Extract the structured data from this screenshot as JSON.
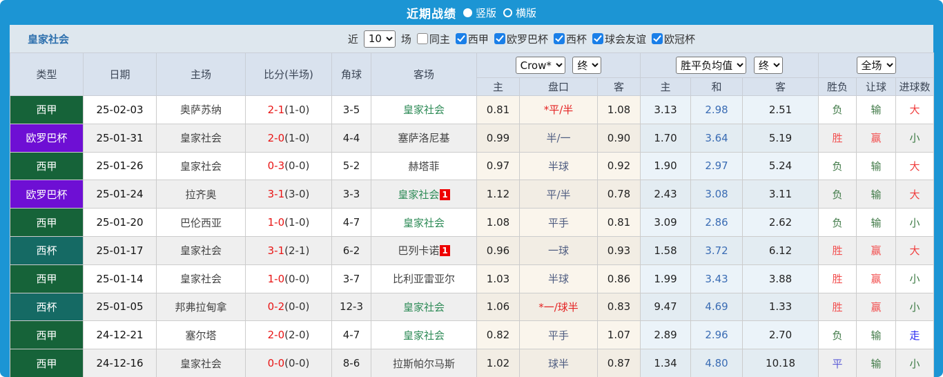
{
  "titlebar": {
    "title": "近期战绩",
    "options": [
      "竖版",
      "横版"
    ],
    "selected": "竖版"
  },
  "filterbar": {
    "team": "皇家社会",
    "near_label": "近",
    "count_value": "10",
    "games_label": "场",
    "checkboxes": [
      {
        "label": "同主",
        "checked": false
      },
      {
        "label": "西甲",
        "checked": true
      },
      {
        "label": "欧罗巴杯",
        "checked": true
      },
      {
        "label": "西杯",
        "checked": true
      },
      {
        "label": "球会友谊",
        "checked": true
      },
      {
        "label": "欧冠杯",
        "checked": true
      }
    ]
  },
  "table": {
    "selects": {
      "company": "Crow*",
      "company_state": "终",
      "avg": "胜平负均值",
      "avg_state": "终",
      "scope": "全场"
    },
    "columns": [
      "类型",
      "日期",
      "主场",
      "比分(半场)",
      "角球",
      "客场"
    ],
    "subcolumns": [
      "主",
      "盘口",
      "客",
      "主",
      "和",
      "客",
      "胜负",
      "让球",
      "进球数"
    ],
    "rows": [
      {
        "type": "西甲",
        "date": "25-02-03",
        "home": "奥萨苏纳",
        "score": "2-1",
        "half": "(1-0)",
        "corners": "3-5",
        "away": "皇家社会",
        "away_badge": "",
        "crow_home": "0.81",
        "handicap": "*平/半",
        "crow_away": "1.08",
        "avg_home": "3.13",
        "avg_draw": "2.98",
        "avg_away": "2.51",
        "result": "负",
        "cover": "输",
        "goals": "大"
      },
      {
        "type": "欧罗巴杯",
        "date": "25-01-31",
        "home": "皇家社会",
        "score": "2-0",
        "half": "(1-0)",
        "corners": "4-4",
        "away": "塞萨洛尼基",
        "away_badge": "",
        "crow_home": "0.99",
        "handicap": "半/一",
        "crow_away": "0.90",
        "avg_home": "1.70",
        "avg_draw": "3.64",
        "avg_away": "5.19",
        "result": "胜",
        "cover": "赢",
        "goals": "小"
      },
      {
        "type": "西甲",
        "date": "25-01-26",
        "home": "皇家社会",
        "score": "0-3",
        "half": "(0-0)",
        "corners": "5-2",
        "away": "赫塔菲",
        "away_badge": "",
        "crow_home": "0.97",
        "handicap": "半球",
        "crow_away": "0.92",
        "avg_home": "1.90",
        "avg_draw": "2.97",
        "avg_away": "5.24",
        "result": "负",
        "cover": "输",
        "goals": "大"
      },
      {
        "type": "欧罗巴杯",
        "date": "25-01-24",
        "home": "拉齐奥",
        "score": "3-1",
        "half": "(3-0)",
        "corners": "3-3",
        "away": "皇家社会",
        "away_badge": "1",
        "crow_home": "1.12",
        "handicap": "平/半",
        "crow_away": "0.78",
        "avg_home": "2.43",
        "avg_draw": "3.08",
        "avg_away": "3.11",
        "result": "负",
        "cover": "输",
        "goals": "大"
      },
      {
        "type": "西甲",
        "date": "25-01-20",
        "home": "巴伦西亚",
        "score": "1-0",
        "half": "(1-0)",
        "corners": "4-7",
        "away": "皇家社会",
        "away_badge": "",
        "crow_home": "1.08",
        "handicap": "平手",
        "crow_away": "0.81",
        "avg_home": "3.09",
        "avg_draw": "2.86",
        "avg_away": "2.62",
        "result": "负",
        "cover": "输",
        "goals": "小"
      },
      {
        "type": "西杯",
        "date": "25-01-17",
        "home": "皇家社会",
        "score": "3-1",
        "half": "(2-1)",
        "corners": "6-2",
        "away": "巴列卡诺",
        "away_badge": "1",
        "crow_home": "0.96",
        "handicap": "一球",
        "crow_away": "0.93",
        "avg_home": "1.58",
        "avg_draw": "3.72",
        "avg_away": "6.12",
        "result": "胜",
        "cover": "赢",
        "goals": "大"
      },
      {
        "type": "西甲",
        "date": "25-01-14",
        "home": "皇家社会",
        "score": "1-0",
        "half": "(0-0)",
        "corners": "3-7",
        "away": "比利亚雷亚尔",
        "away_badge": "",
        "crow_home": "1.03",
        "handicap": "半球",
        "crow_away": "0.86",
        "avg_home": "1.99",
        "avg_draw": "3.43",
        "avg_away": "3.88",
        "result": "胜",
        "cover": "赢",
        "goals": "小"
      },
      {
        "type": "西杯",
        "date": "25-01-05",
        "home": "邦弗拉甸拿",
        "score": "0-2",
        "half": "(0-0)",
        "corners": "12-3",
        "away": "皇家社会",
        "away_badge": "",
        "crow_home": "1.06",
        "handicap": "*一/球半",
        "crow_away": "0.83",
        "avg_home": "9.47",
        "avg_draw": "4.69",
        "avg_away": "1.33",
        "result": "胜",
        "cover": "赢",
        "goals": "小"
      },
      {
        "type": "西甲",
        "date": "24-12-21",
        "home": "塞尔塔",
        "score": "2-0",
        "half": "(2-0)",
        "corners": "4-7",
        "away": "皇家社会",
        "away_badge": "",
        "crow_home": "0.82",
        "handicap": "平手",
        "crow_away": "1.07",
        "avg_home": "2.89",
        "avg_draw": "2.96",
        "avg_away": "2.70",
        "result": "负",
        "cover": "输",
        "goals": "走"
      },
      {
        "type": "西甲",
        "date": "24-12-16",
        "home": "皇家社会",
        "score": "0-0",
        "half": "(0-0)",
        "corners": "8-6",
        "away": "拉斯帕尔马斯",
        "away_badge": "",
        "crow_home": "1.02",
        "handicap": "球半",
        "crow_away": "0.87",
        "avg_home": "1.34",
        "avg_draw": "4.80",
        "avg_away": "10.18",
        "result": "平",
        "cover": "输",
        "goals": "小"
      }
    ]
  },
  "colors": {
    "topbar_blue": "#1c95d4",
    "checkbox_blue": "#1a7fe8",
    "team_highlight_green": "#2e8b57",
    "score_red": "#e81414",
    "draw_odds_blue": "#3a6cb4",
    "competitions": {
      "西甲": "#166339",
      "欧罗巴杯": "#6e0fd4",
      "西杯": "#156a64"
    },
    "values": {
      "胜": "#f25050",
      "负": "#417a48",
      "平": "#5c5cd6",
      "赢": "#f25050",
      "输": "#417a48",
      "大": "#f03c3c",
      "小": "#3c7a44",
      "走": "#2828f0"
    }
  }
}
